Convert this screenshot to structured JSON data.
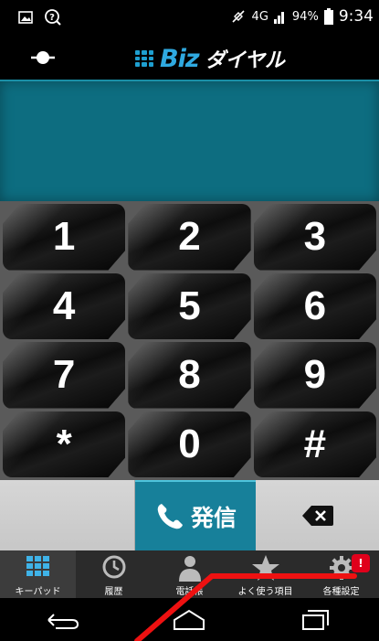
{
  "status_bar": {
    "network": "4G",
    "battery": "94%",
    "time": "9:34"
  },
  "header": {
    "brand": "Biz",
    "title": "ダイヤル",
    "accent_color": "#2fa9e0"
  },
  "display": {
    "number": ""
  },
  "keypad": {
    "keys": [
      "1",
      "2",
      "3",
      "4",
      "5",
      "6",
      "7",
      "8",
      "9",
      "*",
      "0",
      "#"
    ]
  },
  "actions": {
    "call_label": "発信"
  },
  "tabs": [
    {
      "label": "キーパッド",
      "icon": "keypad-icon",
      "active": true
    },
    {
      "label": "履歴",
      "icon": "clock-icon",
      "active": false
    },
    {
      "label": "電話帳",
      "icon": "person-icon",
      "active": false
    },
    {
      "label": "よく使う項目",
      "icon": "star-icon",
      "active": false
    },
    {
      "label": "各種設定",
      "icon": "gear-icon",
      "active": false
    }
  ],
  "settings_badge": "!"
}
